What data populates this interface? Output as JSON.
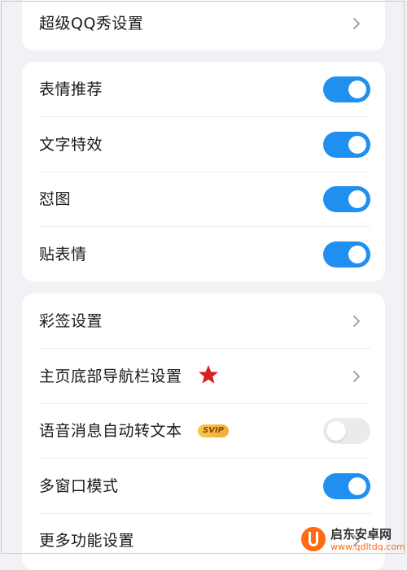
{
  "card1": {
    "items": [
      {
        "label": "超级QQ秀设置",
        "control": "chevron"
      }
    ]
  },
  "card2": {
    "items": [
      {
        "label": "表情推荐",
        "control": "toggle",
        "on": true
      },
      {
        "label": "文字特效",
        "control": "toggle",
        "on": true
      },
      {
        "label": "怼图",
        "control": "toggle",
        "on": true
      },
      {
        "label": "贴表情",
        "control": "toggle",
        "on": true
      }
    ]
  },
  "card3": {
    "items": [
      {
        "label": "彩签设置",
        "control": "chevron"
      },
      {
        "label": "主页底部导航栏设置",
        "control": "chevron",
        "marker": "star-icon"
      },
      {
        "label": "语音消息自动转文本",
        "control": "toggle",
        "on": false,
        "badge": "SVIP"
      },
      {
        "label": "多窗口模式",
        "control": "toggle",
        "on": true
      },
      {
        "label": "更多功能设置",
        "control": "chevron"
      }
    ]
  },
  "watermark": {
    "title": "启东安卓网",
    "url": "www.qdltdq.com"
  },
  "colors": {
    "toggle_on": "#1f8ff0",
    "toggle_off": "#ebebeb",
    "star": "#d8211e",
    "accent": "#ff6a13"
  }
}
